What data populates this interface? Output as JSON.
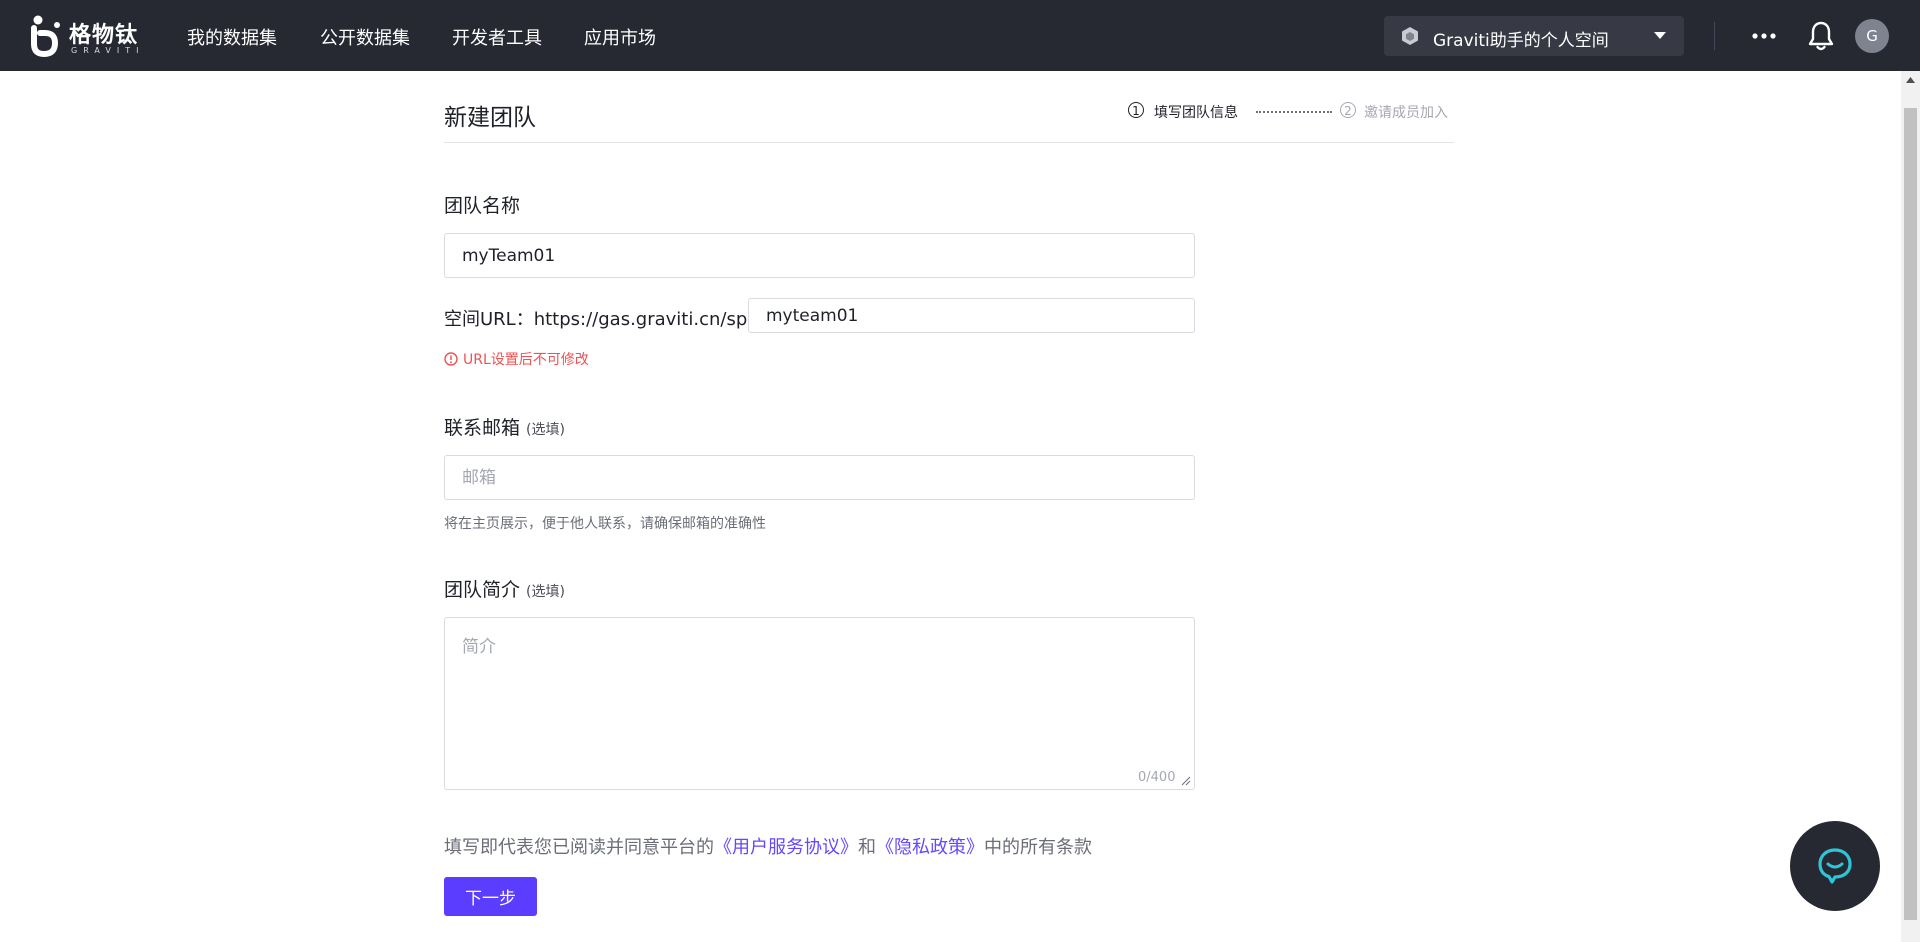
{
  "header": {
    "brand_name": "格物钛",
    "brand_sub": "GRAVITI",
    "nav": [
      {
        "label": "我的数据集"
      },
      {
        "label": "公开数据集"
      },
      {
        "label": "开发者工具"
      },
      {
        "label": "应用市场"
      }
    ],
    "space_selector": "Graviti助手的个人空间",
    "avatar_initial": "G"
  },
  "page": {
    "title": "新建团队",
    "steps": [
      {
        "number": "1",
        "label": "填写团队信息"
      },
      {
        "number": "2",
        "label": "邀请成员加入"
      }
    ]
  },
  "form": {
    "team_name": {
      "label": "团队名称",
      "value": "myTeam01"
    },
    "space_url": {
      "label": "空间URL：",
      "prefix": "https://gas.graviti.cn/space/",
      "value": "myteam01",
      "error": "URL设置后不可修改"
    },
    "email": {
      "label": "联系邮箱",
      "optional": "(选填)",
      "placeholder": "邮箱",
      "hint": "将在主页展示，便于他人联系，请确保邮箱的准确性"
    },
    "intro": {
      "label": "团队简介",
      "optional": "(选填)",
      "placeholder": "简介",
      "counter": "0/400"
    },
    "agreement": {
      "prefix": "填写即代表您已阅读并同意平台的",
      "terms_link": "《用户服务协议》",
      "and": "和",
      "privacy_link": "《隐私政策》",
      "suffix": "中的所有条款"
    },
    "next_button": "下一步"
  },
  "colors": {
    "topbar": "#262832",
    "primary": "#5a3dff",
    "link": "#6448ff",
    "error": "#f05252"
  }
}
